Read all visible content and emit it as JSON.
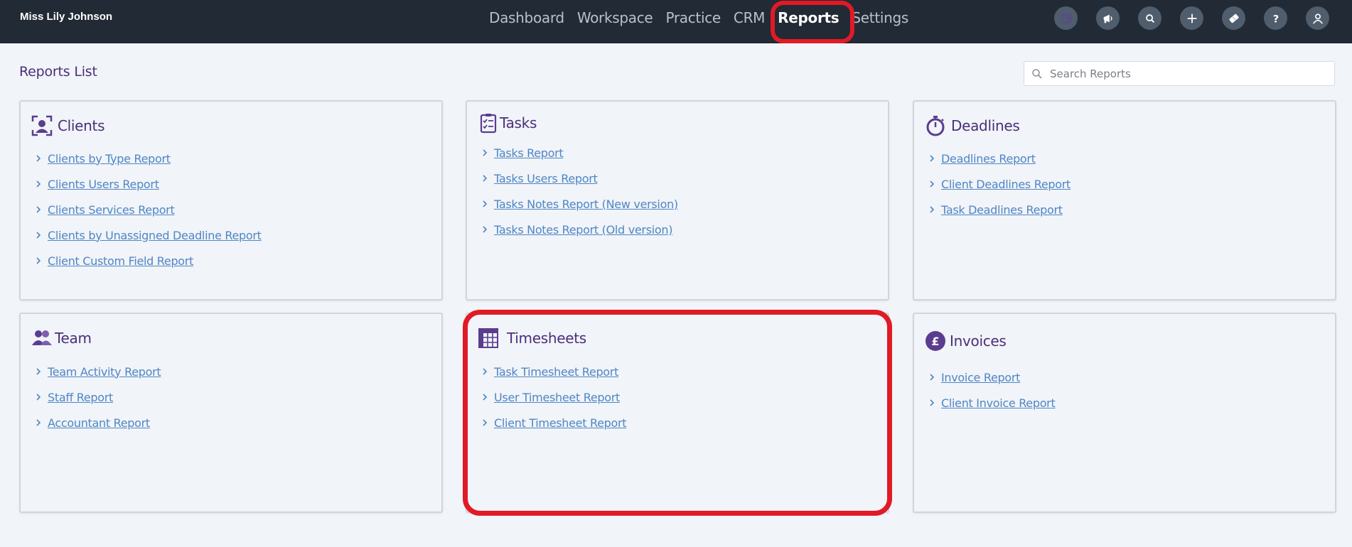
{
  "header": {
    "user_name": "Miss Lily Johnson",
    "nav": [
      "Dashboard",
      "Workspace",
      "Practice",
      "CRM",
      "Reports",
      "Settings"
    ],
    "active_nav": "Reports"
  },
  "page": {
    "title": "Reports List",
    "search_placeholder": "Search Reports"
  },
  "cards": {
    "clients": {
      "title": "Clients",
      "links": [
        "Clients by Type Report",
        "Clients Users Report",
        "Clients Services Report",
        "Clients by Unassigned Deadline Report",
        "Client Custom Field Report"
      ]
    },
    "tasks": {
      "title": "Tasks",
      "links": [
        "Tasks Report",
        "Tasks Users Report",
        "Tasks Notes Report (New version)",
        "Tasks Notes Report (Old version)"
      ]
    },
    "deadlines": {
      "title": "Deadlines",
      "links": [
        "Deadlines Report",
        "Client Deadlines Report",
        "Task Deadlines Report"
      ]
    },
    "team": {
      "title": "Team",
      "links": [
        "Team Activity Report",
        "Staff Report",
        "Accountant Report"
      ]
    },
    "timesheets": {
      "title": "Timesheets",
      "links": [
        "Task Timesheet Report",
        "User Timesheet Report",
        "Client Timesheet Report"
      ]
    },
    "invoices": {
      "title": "Invoices",
      "links": [
        "Invoice Report",
        "Client Invoice Report"
      ]
    }
  },
  "colors": {
    "header_bg": "#222a35",
    "accent_purple": "#4a2f7a",
    "link_blue": "#4f86c6",
    "highlight_red": "#e11a26"
  }
}
